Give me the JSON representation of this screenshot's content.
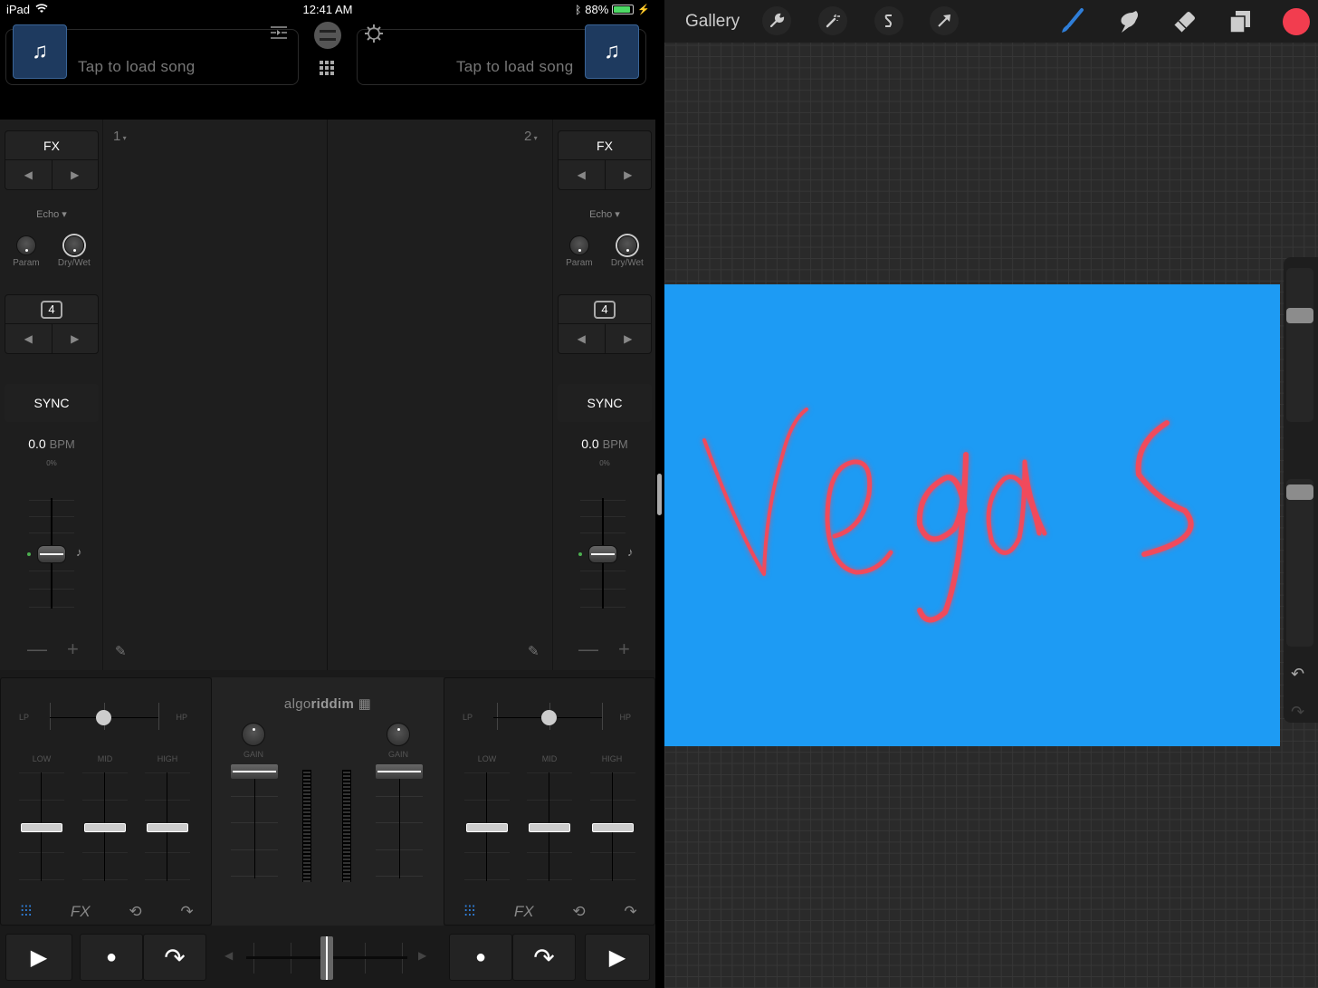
{
  "status_bar": {
    "device": "iPad",
    "time": "12:41 AM",
    "battery": "88%",
    "battery_level": 0.88
  },
  "djay": {
    "decks": [
      {
        "id": "1",
        "load_text": "Tap to load song",
        "deck_label": "1",
        "fx_label": "FX",
        "effect": "Echo",
        "knobs": [
          "Param",
          "Dry/Wet"
        ],
        "loop_size": "4",
        "sync_label": "SYNC",
        "bpm_value": "0.0",
        "bpm_unit": "BPM",
        "pitch_percent": "0%",
        "minus": "—",
        "plus": "+"
      },
      {
        "id": "2",
        "load_text": "Tap to load song",
        "deck_label": "2",
        "fx_label": "FX",
        "effect": "Echo",
        "knobs": [
          "Param",
          "Dry/Wet"
        ],
        "loop_size": "4",
        "sync_label": "SYNC",
        "bpm_value": "0.0",
        "bpm_unit": "BPM",
        "pitch_percent": "0%",
        "minus": "—",
        "plus": "+"
      }
    ],
    "mixer": {
      "brand_light": "algo",
      "brand_bold": "riddim",
      "gain_label": "GAIN",
      "filter_lp": "LP",
      "filter_hp": "HP",
      "eq_bands": [
        "LOW",
        "MID",
        "HIGH"
      ],
      "eq_tabs": [
        "eq",
        "FX",
        "loop",
        "skip"
      ],
      "crossfader_position": 0.5
    },
    "accent_color": "#2f7ed8"
  },
  "procreate": {
    "gallery_label": "Gallery",
    "left_tools": [
      "wrench-icon",
      "magic-wand-icon",
      "selection-icon",
      "transform-icon"
    ],
    "right_tools": [
      "brush-icon",
      "smudge-icon",
      "eraser-icon",
      "layers-icon"
    ],
    "current_color": "#f23d4f",
    "canvas_color": "#1d9bf4",
    "drawing_text": "Vegas",
    "brush_size": 0.12,
    "opacity": 0.9
  }
}
